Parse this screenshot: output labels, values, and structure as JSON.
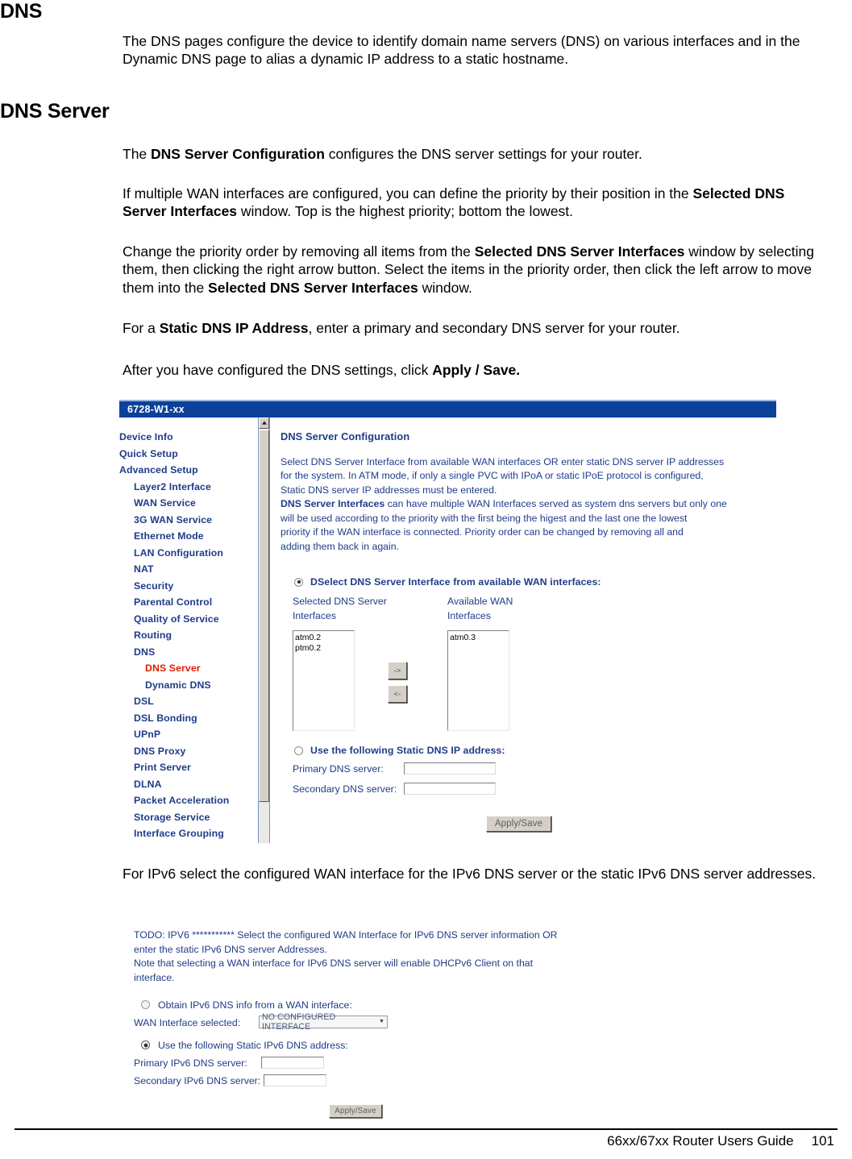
{
  "document": {
    "heading_dns": "DNS",
    "intro": "The DNS pages configure the device to identify domain name servers (DNS) on various interfaces and in the Dynamic DNS page to alias a dynamic IP address to a static hostname.",
    "heading_dns_server": "DNS Server",
    "para1_pre": "The ",
    "para1_bold": "DNS Server Configuration",
    "para1_post": " configures the DNS server settings for your router.",
    "para2_pre": "If multiple WAN interfaces are configured, you can define the priority by their position in the ",
    "para2_bold": "Selected DNS Server Interfaces",
    "para2_post": " window. Top is the highest priority; bottom the lowest.",
    "para3_a": "Change the priority order by removing all items from the ",
    "para3_b1": "Selected DNS Server Interfaces",
    "para3_c": " window by selecting them, then clicking the right arrow button. Select the items in the priority order, then click the left arrow to move them into the ",
    "para3_b2": "Selected DNS Server Interfaces",
    "para3_d": " window.",
    "para4_pre": "For a ",
    "para4_bold": "Static DNS IP Address",
    "para4_post": ", enter a primary and secondary DNS server for your router.",
    "para5_pre": "After you have configured the DNS settings, click ",
    "para5_bold": "Apply / Save.",
    "para6": "For IPv6 select the configured WAN interface for the IPv6 DNS server or the static IPv6 DNS server addresses."
  },
  "footer": {
    "guide": "66xx/67xx Router Users Guide",
    "page": "101"
  },
  "router_ui": {
    "title": "6728-W1-xx",
    "title_bar_color": "#0B4199",
    "nav_link_color": "#1F3C88",
    "nav_active_color": "#E01B00",
    "nav": [
      {
        "label": "Device Info",
        "level": 0,
        "active": false
      },
      {
        "label": "Quick Setup",
        "level": 0,
        "active": false
      },
      {
        "label": "Advanced Setup",
        "level": 0,
        "active": false
      },
      {
        "label": "Layer2 Interface",
        "level": 1,
        "active": false
      },
      {
        "label": "WAN Service",
        "level": 1,
        "active": false
      },
      {
        "label": "3G WAN Service",
        "level": 1,
        "active": false
      },
      {
        "label": "Ethernet Mode",
        "level": 1,
        "active": false
      },
      {
        "label": "LAN Configuration",
        "level": 1,
        "active": false
      },
      {
        "label": "NAT",
        "level": 1,
        "active": false
      },
      {
        "label": "Security",
        "level": 1,
        "active": false
      },
      {
        "label": "Parental Control",
        "level": 1,
        "active": false
      },
      {
        "label": "Quality of Service",
        "level": 1,
        "active": false
      },
      {
        "label": "Routing",
        "level": 1,
        "active": false
      },
      {
        "label": "DNS",
        "level": 1,
        "active": false
      },
      {
        "label": "DNS Server",
        "level": 2,
        "active": true
      },
      {
        "label": "Dynamic DNS",
        "level": 2,
        "active": false
      },
      {
        "label": "DSL",
        "level": 1,
        "active": false
      },
      {
        "label": "DSL Bonding",
        "level": 1,
        "active": false
      },
      {
        "label": "UPnP",
        "level": 1,
        "active": false
      },
      {
        "label": "DNS Proxy",
        "level": 1,
        "active": false
      },
      {
        "label": "Print Server",
        "level": 1,
        "active": false
      },
      {
        "label": "DLNA",
        "level": 1,
        "active": false
      },
      {
        "label": "Packet Acceleration",
        "level": 1,
        "active": false
      },
      {
        "label": "Storage Service",
        "level": 1,
        "active": false
      },
      {
        "label": "Interface Grouping",
        "level": 1,
        "active": false
      }
    ],
    "pane_title": "DNS Server Configuration",
    "desc_l1": "Select DNS Server Interface from available WAN interfaces OR enter static DNS server IP addresses",
    "desc_l2": "for the system. In ATM mode, if only a single PVC with IPoA or static IPoE protocol is configured,",
    "desc_l3": "Static DNS server IP addresses must be entered.",
    "desc_l4_bold": "DNS Server Interfaces",
    "desc_l4": " can have multiple WAN Interfaces served as system dns servers but only one",
    "desc_l5": "will be used according to the priority with the first being the higest and the last one the lowest",
    "desc_l6": "priority if the WAN interface is connected. Priority order can be changed by removing all and",
    "desc_l7": "adding them back in again.",
    "radio_select_label": "DSelect DNS Server Interface from available WAN interfaces:",
    "radio_select_checked": true,
    "selected_col_l1": "Selected DNS Server",
    "selected_col_l2": "Interfaces",
    "available_col_l1": "Available WAN",
    "available_col_l2": "Interfaces",
    "selected_list": [
      "atm0.2",
      "ptm0.2"
    ],
    "available_list": [
      "atm0.3"
    ],
    "btn_right": "->",
    "btn_left": "<-",
    "radio_static_label": "Use the following Static DNS IP address:",
    "radio_static_checked": false,
    "primary_label": "Primary DNS server:",
    "primary_value": "",
    "secondary_label": "Secondary DNS server:",
    "secondary_value": "",
    "apply_save": "Apply/Save"
  },
  "ipv6_ui": {
    "desc_l1": "TODO: IPV6 *********** Select the configured WAN Interface for IPv6 DNS server information OR",
    "desc_l2": "enter the static IPv6 DNS server Addresses.",
    "desc_l3": "Note that selecting a WAN interface for IPv6 DNS server will enable DHCPv6 Client on that",
    "desc_l4": "interface.",
    "radio_obtain_label": "Obtain IPv6 DNS info from a WAN interface:",
    "radio_obtain_checked": false,
    "wan_iface_label": "WAN Interface selected:",
    "wan_iface_value": "NO CONFIGURED INTERFACE",
    "radio_static_label": "Use the following Static IPv6 DNS address:",
    "radio_static_checked": true,
    "primary_label": "Primary IPv6 DNS server:",
    "primary_value": "",
    "secondary_label": "Secondary IPv6 DNS server:",
    "secondary_value": "",
    "apply_save": "Apply/Save"
  }
}
